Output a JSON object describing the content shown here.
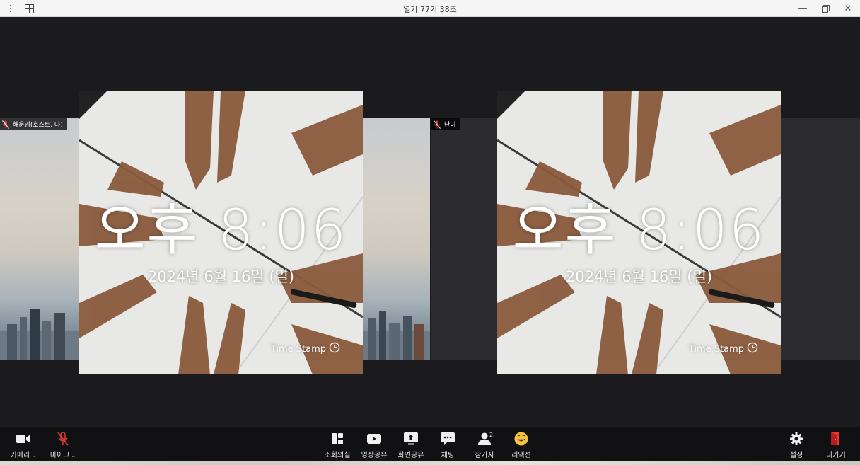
{
  "window": {
    "title": "열기 77기 38조"
  },
  "participants": [
    {
      "name": "해운임(호스트, 나)"
    },
    {
      "name": "난이"
    }
  ],
  "timestamp_overlay": {
    "time": "오후 8:06",
    "date": "2024년 6월 16일 (일)",
    "brand": "Time Stamp"
  },
  "toolbar": {
    "camera_label": "카메라",
    "mic_label": "마이크",
    "breakout_label": "소회의실",
    "video_share_label": "영상공유",
    "screen_share_label": "화면공유",
    "chat_label": "채팅",
    "participants_label": "참가자",
    "participants_count": "2",
    "reaction_label": "리액션",
    "settings_label": "설정",
    "leave_label": "나가기"
  },
  "colors": {
    "leave": "#e53935",
    "mic_muted": "#e53935",
    "reaction": "#f6c33b"
  }
}
